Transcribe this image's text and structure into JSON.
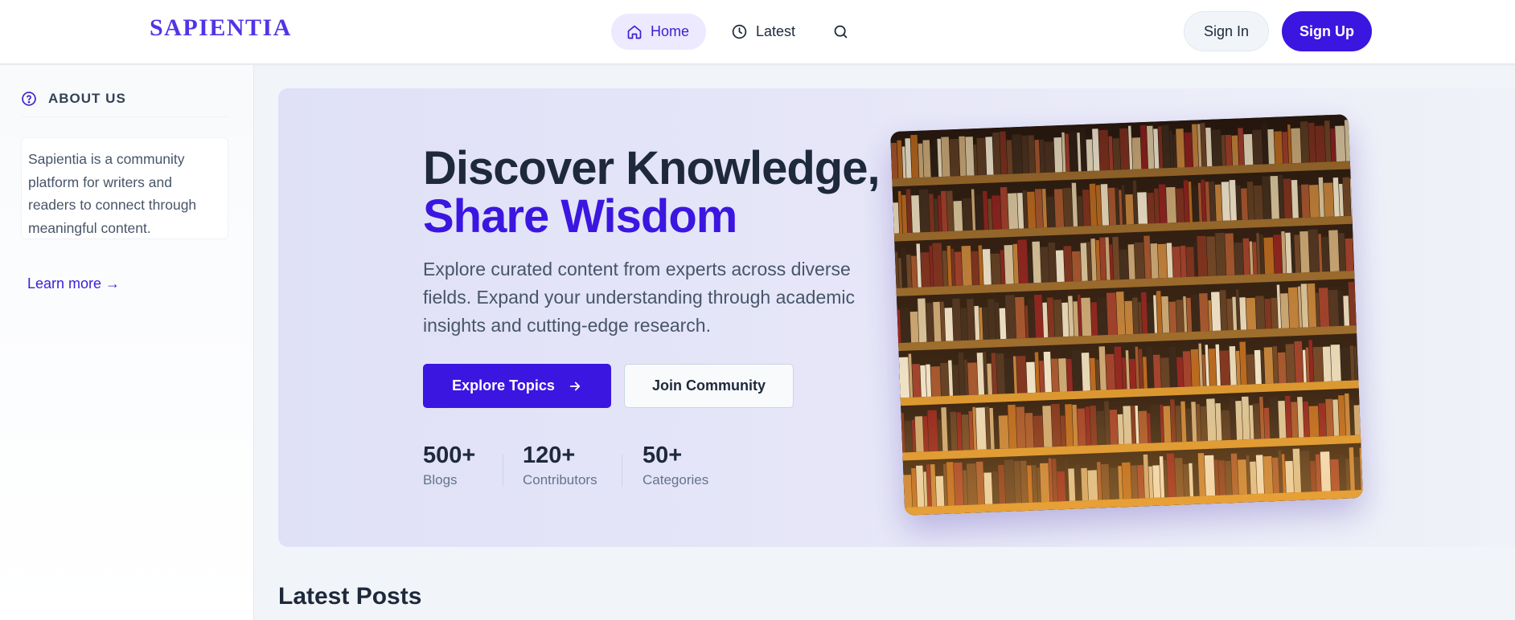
{
  "header": {
    "logo": "SAPIENTIA",
    "nav": [
      {
        "label": "Home",
        "icon": "home-icon"
      },
      {
        "label": "Latest",
        "icon": "clock-icon"
      }
    ],
    "search_icon": "search-icon",
    "sign_in": "Sign In",
    "sign_up": "Sign Up"
  },
  "sidebar": {
    "about_title": "ABOUT US",
    "about_icon": "help-circle-icon",
    "about_text": "Sapientia is a community platform for writers and readers to connect through meaningful content.",
    "learn_more": "Learn more →"
  },
  "hero": {
    "title_line1": "Discover Knowledge,",
    "title_line2": "Share Wisdom",
    "description": "Explore curated content from experts across diverse fields. Expand your understanding through academic insights and cutting-edge research.",
    "explore_button": "Explore Topics",
    "join_button": "Join Community",
    "stats": [
      {
        "value": "500+",
        "label": "Blogs"
      },
      {
        "value": "120+",
        "label": "Contributors"
      },
      {
        "value": "50+",
        "label": "Categories"
      }
    ],
    "image_icon": "bookshelf-image"
  },
  "latest_posts": {
    "title": "Latest Posts"
  },
  "colors": {
    "brand": "#3b16e0",
    "logo": "#4f35e6",
    "text_dark": "#1e293b",
    "text_muted": "#475569"
  }
}
